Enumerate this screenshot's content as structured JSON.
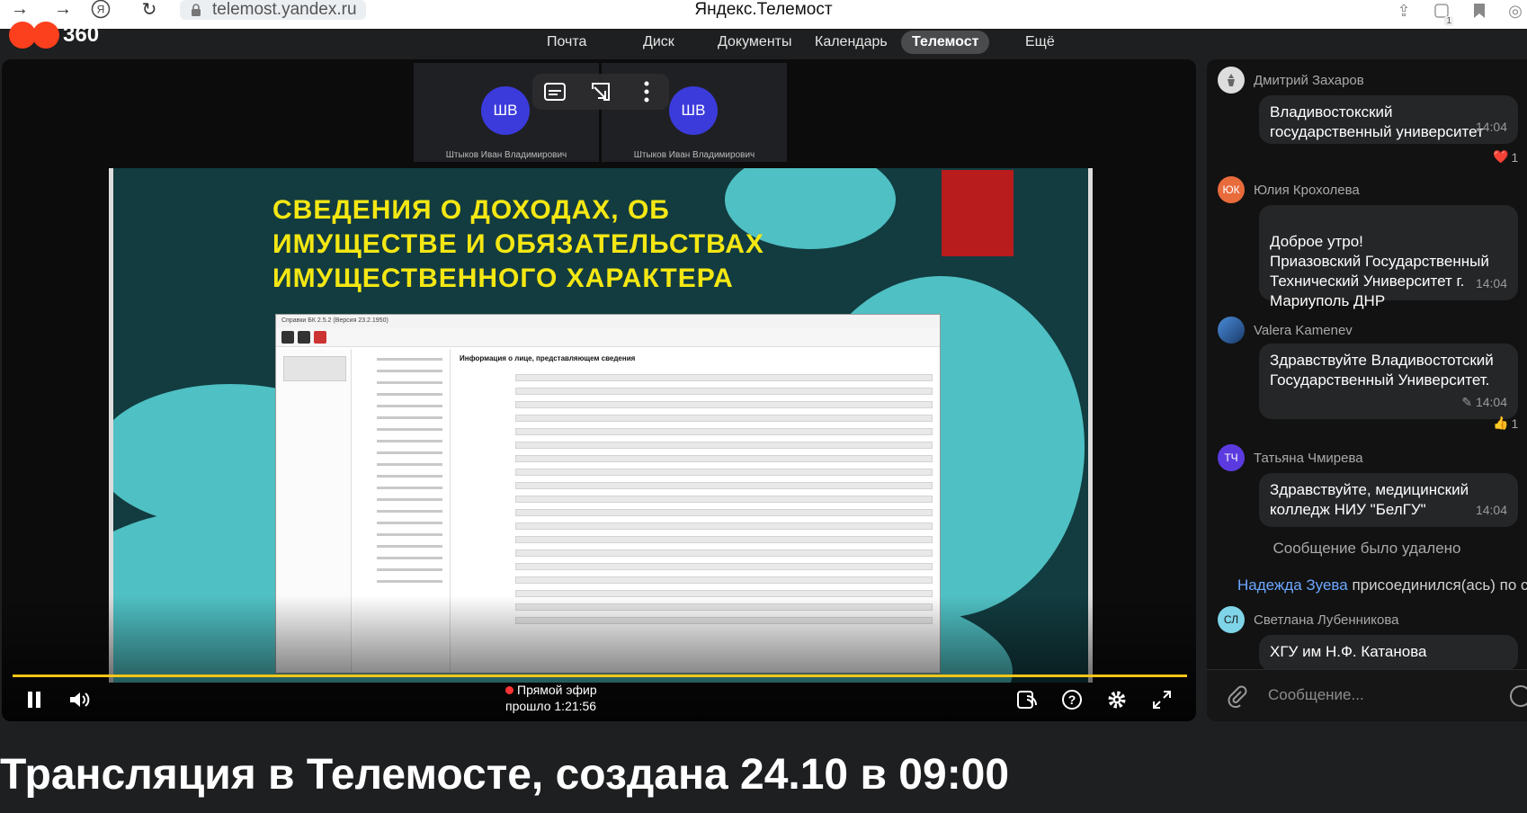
{
  "browser": {
    "url": "telemost.yandex.ru",
    "tab_title": "Яндекс.Телемост",
    "ext_badge": "1"
  },
  "service_nav": {
    "logo_text": "360",
    "items": [
      {
        "label": "Почта"
      },
      {
        "label": "Диск"
      },
      {
        "label": "Документы"
      },
      {
        "label": "Календарь"
      },
      {
        "label": "Телемост",
        "active": true
      },
      {
        "label": "Ещё"
      }
    ]
  },
  "video": {
    "participants": [
      {
        "initials": "ШВ",
        "name": "Штыков Иван Владимирович"
      },
      {
        "initials": "ШВ",
        "name": "Штыков Иван Владимирович"
      }
    ],
    "slide": {
      "title": "СВЕДЕНИЯ О ДОХОДАХ, ОБ ИМУЩЕСТВЕ И ОБЯЗАТЕЛЬСТВАХ ИМУЩЕСТВЕННОГО ХАРАКТЕРА",
      "app_title": "Справки БК 2.5.2 (Версия 23.2.1950)",
      "form_header": "Информация о лице, представляющем сведения"
    },
    "live_label": "Прямой эфир",
    "elapsed": "прошло 1:21:56",
    "progress_color": "#f5c518"
  },
  "chat": {
    "messages": [
      {
        "author": "Дмитрий Захаров",
        "initials": "",
        "text": "Владивостокский государственный университет",
        "time": "14:04",
        "reaction": "❤️",
        "reaction_count": "1"
      },
      {
        "author": "Юлия Крохолева",
        "initials": "ЮК",
        "text": "Доброе утро!\nПриазовский Государственный Технический Университет г. Мариуполь ДНР",
        "time": "14:04"
      },
      {
        "author": "Valera Kamenev",
        "initials": "",
        "text": "Здравствуйте Владивостотский Государственный Университет.",
        "time": "14:04",
        "edited_icon": "✎",
        "reaction": "👍",
        "reaction_count": "1"
      },
      {
        "author": "Татьяна Чмирева",
        "initials": "ТЧ",
        "text": "Здравствуйте, медицинский колледж НИУ \"БелГУ\"",
        "time": "14:04"
      },
      {
        "author": "Светлана Лубенникова",
        "initials": "СЛ",
        "text": "ХГУ им Н.Ф. Катанова",
        "time": ""
      }
    ],
    "deleted_notice": "Сообщение было удалено",
    "joined": {
      "name": "Надежда Зуева",
      "text": "присоединился(ась) по с"
    },
    "input_placeholder": "Сообщение..."
  },
  "page": {
    "title": "Трансляция в Телемосте, создана 24.10 в 09:00"
  }
}
